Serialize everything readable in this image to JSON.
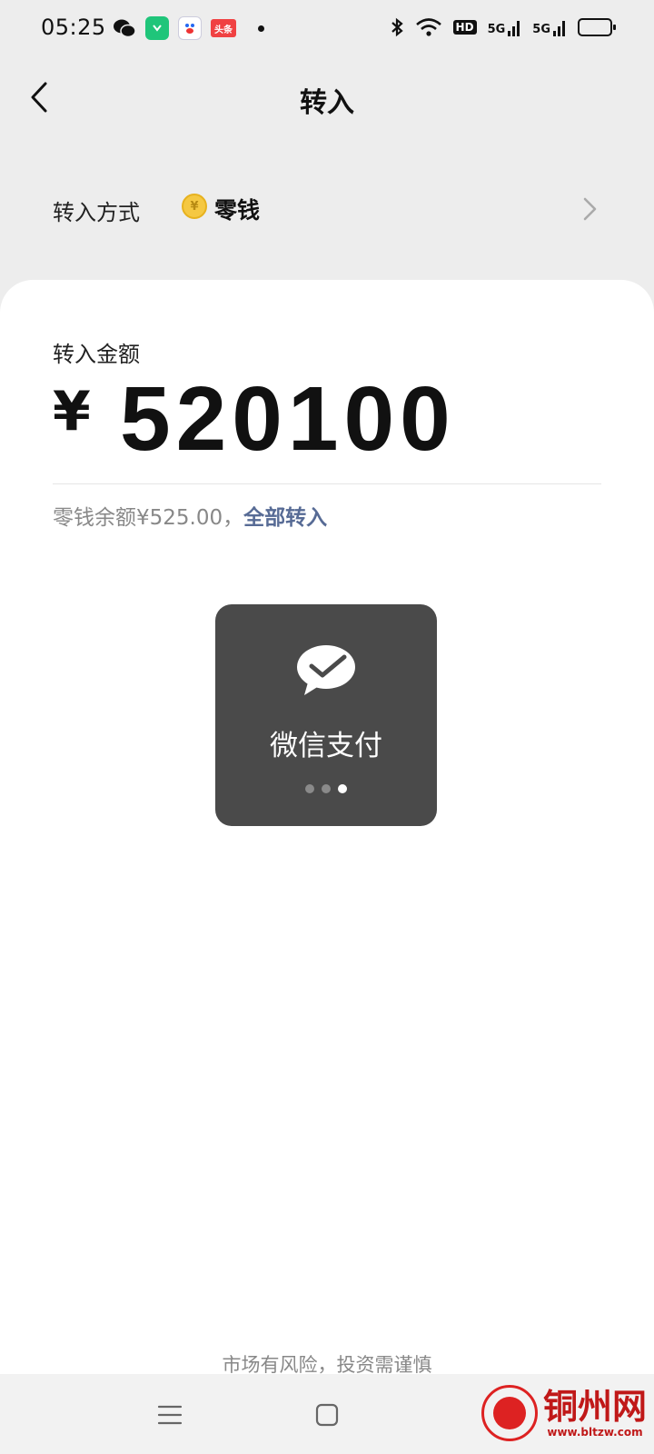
{
  "status_bar": {
    "time": "05:25",
    "app_icons": [
      "wechat-icon",
      "green-app-icon",
      "baidu-icon",
      "toutiao-icon"
    ],
    "toutiao_text": "头条",
    "hd_label": "HD",
    "signal_1": "5G",
    "signal_2": "5G"
  },
  "nav": {
    "title": "转入"
  },
  "method": {
    "label": "转入方式",
    "value": "零钱"
  },
  "amount": {
    "label": "转入金额",
    "currency": "¥",
    "value": "520100"
  },
  "balance": {
    "text": "零钱余额¥525.00，",
    "link": "全部转入"
  },
  "toast": {
    "text": "微信支付",
    "dots": 3,
    "active_dot": 2
  },
  "footer": {
    "risk_text": "市场有风险，投资需谨慎"
  },
  "watermark": {
    "title": "铜州网",
    "url": "www.bltzw.com"
  },
  "colors": {
    "link": "#576b95",
    "toast_bg": "#4a4a4a",
    "card_bg": "#ffffff",
    "page_bg": "#ededed"
  }
}
